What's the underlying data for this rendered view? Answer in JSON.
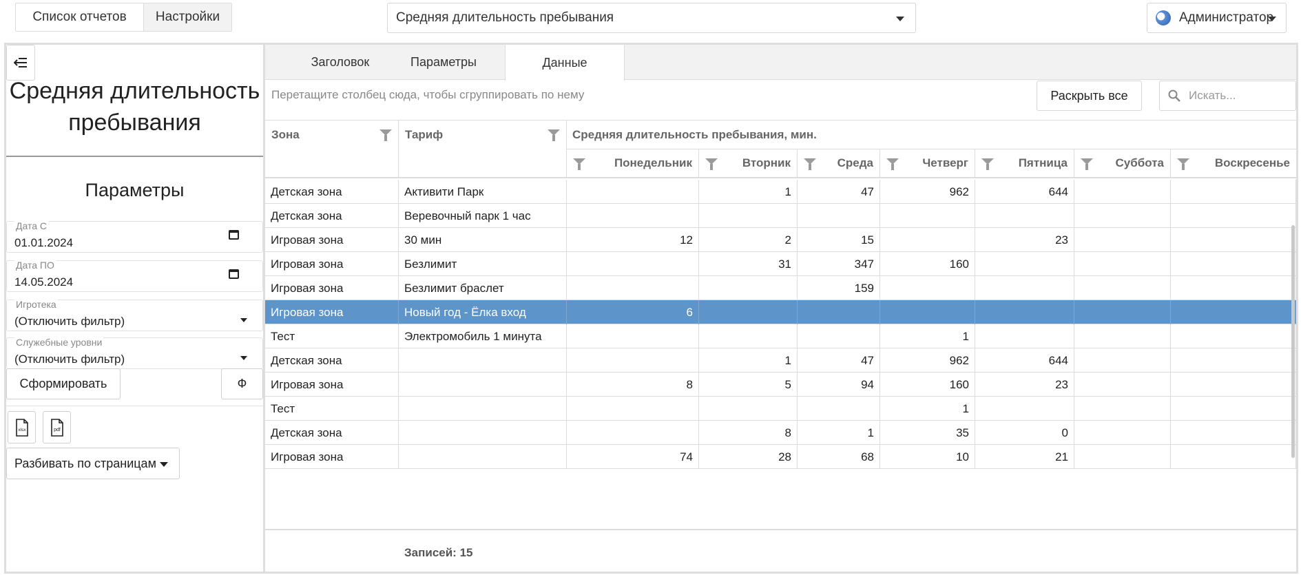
{
  "topbar": {
    "reports_label": "Список отчетов",
    "settings_label": "Настройки",
    "selected_report": "Средняя длительность пребывания",
    "user_label": "Администратор"
  },
  "left": {
    "report_title": "Средняя длительность пребывания",
    "params_heading": "Параметры",
    "date_from_label": "Дата С",
    "date_from_value": "01.01.2024",
    "date_to_label": "Дата ПО",
    "date_to_value": "14.05.2024",
    "playroom_label": "Игротека",
    "playroom_value": "(Отключить фильтр)",
    "service_levels_label": "Служебные уровни",
    "service_levels_value": "(Отключить фильтр)",
    "generate_label": "Сформировать",
    "f_label": "Ф",
    "xlsx_label": "xlsx",
    "pdf_label": "pdf",
    "paging_label": "Разбивать по страницам"
  },
  "tabs": [
    {
      "label": "Заголовок",
      "active": false
    },
    {
      "label": "Параметры",
      "active": false
    },
    {
      "label": "Данные",
      "active": true
    }
  ],
  "toolbar": {
    "group_hint": "Перетащите столбец сюда, чтобы сгруппировать по нему",
    "expand_label": "Раскрыть все",
    "search_placeholder": "Искать..."
  },
  "grid": {
    "col_zone": "Зона",
    "col_tariff": "Тариф",
    "band_title": "Средняя длительность пребывания, мин.",
    "days": [
      "Понедельник",
      "Вторник",
      "Среда",
      "Четверг",
      "Пятница",
      "Суббота",
      "Воскресенье"
    ],
    "rows": [
      {
        "zone": "Детская зона",
        "tariff": "Активити Парк",
        "vals": [
          "",
          "1",
          "47",
          "962",
          "644",
          "",
          ""
        ],
        "selected": false
      },
      {
        "zone": "Детская зона",
        "tariff": "Веревочный парк 1 час",
        "vals": [
          "",
          "",
          "",
          "",
          "",
          "",
          ""
        ],
        "selected": false
      },
      {
        "zone": "Игровая зона",
        "tariff": "30 мин",
        "vals": [
          "12",
          "2",
          "15",
          "",
          "23",
          "",
          ""
        ],
        "selected": false
      },
      {
        "zone": "Игровая зона",
        "tariff": "Безлимит",
        "vals": [
          "",
          "31",
          "347",
          "160",
          "",
          "",
          ""
        ],
        "selected": false
      },
      {
        "zone": "Игровая зона",
        "tariff": "Безлимит браслет",
        "vals": [
          "",
          "",
          "159",
          "",
          "",
          "",
          ""
        ],
        "selected": false
      },
      {
        "zone": "Игровая зона",
        "tariff": "Новый год - Ёлка вход",
        "vals": [
          "6",
          "",
          "",
          "",
          "",
          "",
          ""
        ],
        "selected": true
      },
      {
        "zone": "Тест",
        "tariff": "Электромобиль 1 минута",
        "vals": [
          "",
          "",
          "",
          "1",
          "",
          "",
          ""
        ],
        "selected": false
      },
      {
        "zone": "Детская зона",
        "tariff": "",
        "vals": [
          "",
          "1",
          "47",
          "962",
          "644",
          "",
          ""
        ],
        "selected": false
      },
      {
        "zone": "Игровая зона",
        "tariff": "",
        "vals": [
          "8",
          "5",
          "94",
          "160",
          "23",
          "",
          ""
        ],
        "selected": false
      },
      {
        "zone": "Тест",
        "tariff": "",
        "vals": [
          "",
          "",
          "",
          "1",
          "",
          "",
          ""
        ],
        "selected": false
      },
      {
        "zone": "Детская зона",
        "tariff": "",
        "vals": [
          "",
          "8",
          "1",
          "35",
          "0",
          "",
          ""
        ],
        "selected": false
      },
      {
        "zone": "Игровая зона",
        "tariff": "",
        "vals": [
          "74",
          "28",
          "68",
          "10",
          "21",
          "",
          ""
        ],
        "selected": false
      }
    ],
    "records_label": "Записей: 15"
  }
}
